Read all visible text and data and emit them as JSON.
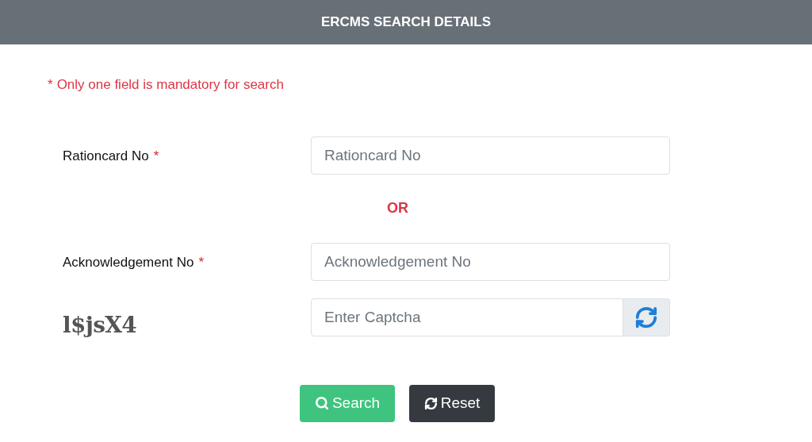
{
  "header": {
    "title": "ERCMS SEARCH DETAILS"
  },
  "note": {
    "mark": "*",
    "text": "Only one field is mandatory for search"
  },
  "fields": [
    {
      "label": "Rationcard No",
      "required_mark": "*",
      "placeholder": "Rationcard No"
    },
    {
      "label": "Acknowledgement No",
      "required_mark": "*",
      "placeholder": "Acknowledgement No"
    }
  ],
  "separator": "OR",
  "captcha": {
    "code": "l$jsX4",
    "placeholder": "Enter Captcha"
  },
  "buttons": [
    {
      "kind": "search",
      "label": "Search"
    },
    {
      "kind": "reset",
      "label": "Reset"
    }
  ]
}
